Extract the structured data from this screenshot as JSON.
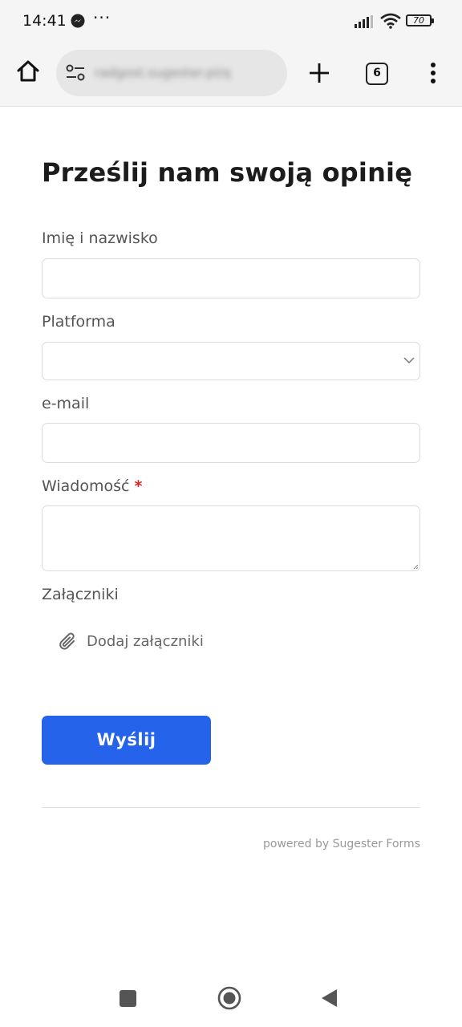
{
  "status_bar": {
    "time": "14:41",
    "more": "···",
    "battery": "70"
  },
  "browser": {
    "url": "radgost.sugester.pl/q",
    "tab_count": "6"
  },
  "form": {
    "title": "Prześlij nam swoją opinię",
    "fields": [
      {
        "label": "Imię i nazwisko",
        "value": ""
      },
      {
        "label": "Platforma",
        "value": ""
      },
      {
        "label": "e-mail",
        "value": ""
      },
      {
        "label": "Wiadomość",
        "required_mark": "*",
        "value": ""
      }
    ],
    "attachments_label": "Załączniki",
    "add_attachments": "Dodaj załączniki",
    "submit_label": "Wyślij",
    "powered_by": "powered by Sugester Forms"
  },
  "colors": {
    "accent": "#2563eb",
    "required": "#dd2222"
  }
}
